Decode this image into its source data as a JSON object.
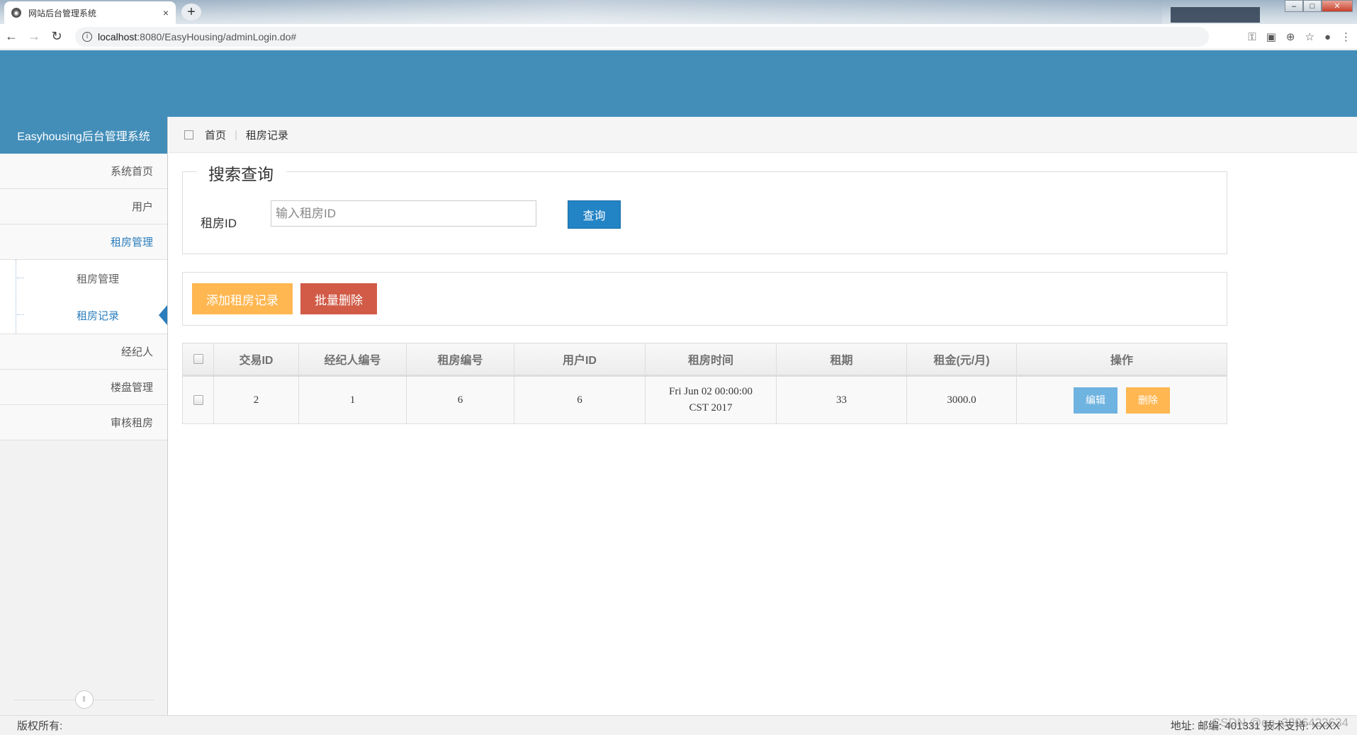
{
  "browser": {
    "tab_title": "网站后台管理系统",
    "tab_close": "×",
    "new_tab": "+",
    "url_host": "localhost",
    "url_path": ":8080/EasyHousing/adminLogin.do#",
    "nav_back": "←",
    "nav_forward": "→",
    "nav_reload": "↻",
    "window_controls": [
      "–",
      "□",
      "✕"
    ]
  },
  "sidebar": {
    "brand": "Easyhousing后台管理系统",
    "items": [
      {
        "label": "系统首页"
      },
      {
        "label": "用户"
      },
      {
        "label": "租房管理"
      },
      {
        "label": "经纪人"
      },
      {
        "label": "楼盘管理"
      },
      {
        "label": "审核租房"
      }
    ],
    "submenu": [
      {
        "label": "租房管理"
      },
      {
        "label": "租房记录"
      }
    ]
  },
  "breadcrumb": {
    "home": "首页",
    "current": "租房记录"
  },
  "search": {
    "legend": "搜索查询",
    "label": "租房ID",
    "placeholder": "输入租房ID",
    "button": "查询"
  },
  "actions": {
    "add": "添加租房记录",
    "bulk_delete": "批量删除"
  },
  "table": {
    "headers": [
      "交易ID",
      "经纪人编号",
      "租房编号",
      "用户ID",
      "租房时间",
      "租期",
      "租金(元/月)",
      "操作"
    ],
    "rows": [
      {
        "id": "2",
        "agent": "1",
        "house": "6",
        "user": "6",
        "time_line1": "Fri Jun 02 00:00:00",
        "time_line2": "CST 2017",
        "term": "33",
        "rent": "3000.0",
        "edit": "编辑",
        "delete": "删除"
      }
    ]
  },
  "footer": {
    "left": "版权所有:",
    "right": "地址:   邮编: 401331 技术支持: XXXX",
    "watermark": "CSDN @qq_3306423634"
  },
  "colors": {
    "header": "#438eb9",
    "primary": "#2283c5",
    "warning": "#ffb752",
    "danger": "#d15b47",
    "info": "#6fb3e0"
  }
}
